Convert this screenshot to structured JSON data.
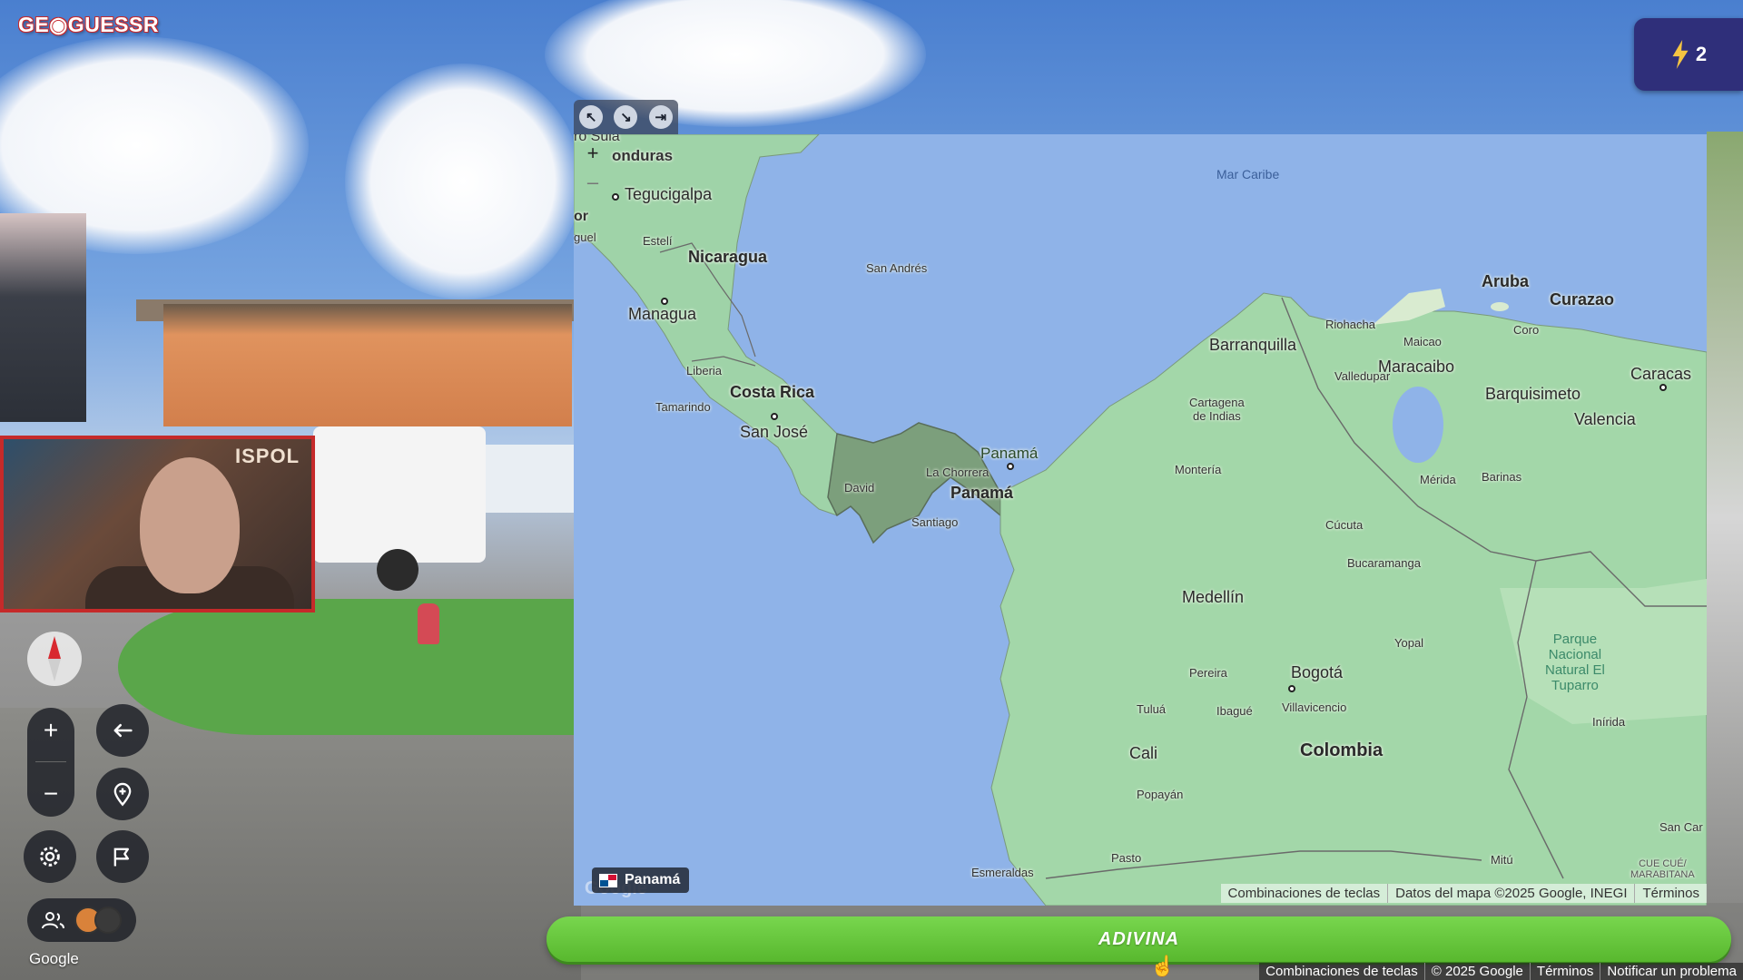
{
  "app": {
    "logo_text": "GE◉GUESSR"
  },
  "energy": {
    "count": "2",
    "icon": "lightning-icon"
  },
  "webcam": {
    "banner_text": "ISPOL"
  },
  "map": {
    "toolbar": {
      "icons": [
        "expand-up-left-icon",
        "shrink-down-right-icon",
        "pin-map-icon"
      ]
    },
    "zoom_in": "+",
    "zoom_out": "–",
    "labels": {
      "mar_caribe": "Mar Caribe",
      "honduras": "onduras",
      "sula": "ro Sula",
      "tegucigalpa": "Tegucigalpa",
      "or": "or",
      "guel": "guel",
      "esteli": "Estelí",
      "nicaragua": "Nicaragua",
      "san_andres": "San Andrés",
      "managua": "Managua",
      "liberia": "Liberia",
      "costa_rica": "Costa Rica",
      "tamarindo": "Tamarindo",
      "san_jose": "San José",
      "panama_region": "Panamá",
      "panama_city": "Panamá",
      "la_chorrera": "La Chorrera",
      "david": "David",
      "santiago": "Santiago",
      "aruba": "Aruba",
      "curazao": "Curazao",
      "riohacha": "Riohacha",
      "maicao": "Maicao",
      "coro": "Coro",
      "barranquilla": "Barranquilla",
      "maracaibo": "Maracaibo",
      "valledupar": "Valledupar",
      "caracas": "Caracas",
      "cartagena": "Cartagena\nde Indias",
      "barquisimeto": "Barquisimeto",
      "valencia": "Valencia",
      "monteria": "Montería",
      "merida": "Mérida",
      "barinas": "Barinas",
      "cucuta": "Cúcuta",
      "bucaramanga": "Bucaramanga",
      "medellin": "Medellín",
      "yopal": "Yopal",
      "pereira": "Pereira",
      "bogota": "Bogotá",
      "tulua": "Tuluá",
      "ibague": "Ibagué",
      "villavicencio": "Villavicencio",
      "cali": "Cali",
      "colombia": "Colombia",
      "popayan": "Popayán",
      "pasto": "Pasto",
      "esmeraldas": "Esmeraldas",
      "mitu": "Mitú",
      "inirida": "Inírida",
      "san_car": "San Car",
      "cuecue": "CUE CUÉ/\nMARABITANA",
      "park": "Parque\nNacional\nNatural El\nTuparro"
    },
    "country_chip": "Panamá",
    "google_mark": "Google",
    "footer": [
      "Combinaciones de teclas",
      "Datos del mapa ©2025 Google, INEGI",
      "Términos"
    ]
  },
  "guess_button": "ADIVINA",
  "controls": {
    "icons": [
      "compass-icon",
      "zoom-in-icon",
      "zoom-out-icon",
      "undo-icon",
      "location-pin-icon",
      "settings-icon",
      "flag-icon",
      "people-icon"
    ]
  },
  "streetview": {
    "google_mark": "Google"
  },
  "footer": [
    "Combinaciones de teclas",
    "© 2025 Google",
    "Términos",
    "Notificar un problema"
  ],
  "colors": {
    "guess_green": "#58b82e",
    "energy_purple": "#2f2f7a",
    "webcam_border": "#c52a2a"
  }
}
